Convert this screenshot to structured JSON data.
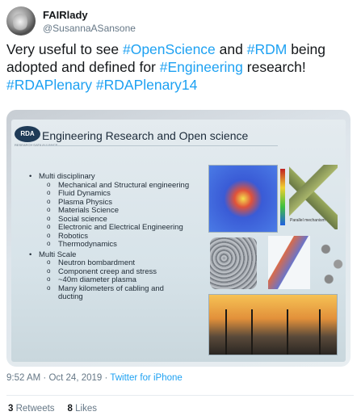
{
  "author": {
    "name": "FAIRlady",
    "handle": "@SusannaASansone"
  },
  "tweet": {
    "text_parts": [
      {
        "text": "Very useful to see ",
        "tag": false
      },
      {
        "text": "#OpenScience",
        "tag": true
      },
      {
        "text": " and ",
        "tag": false
      },
      {
        "text": "#RDM",
        "tag": true
      },
      {
        "text": " being adopted and defined for ",
        "tag": false
      },
      {
        "text": "#Engineering",
        "tag": true
      },
      {
        "text": " research! ",
        "tag": false
      },
      {
        "text": "#RDAPlenary",
        "tag": true
      },
      {
        "text": " ",
        "tag": false
      },
      {
        "text": "#RDAPlenary14",
        "tag": true
      }
    ]
  },
  "slide": {
    "logo": "RDA",
    "logo_sub": "RESEARCH DATA ALLIANCE",
    "title": "Engineering Research and Open science",
    "mech_label": "Parallel mechanism",
    "bullets": [
      {
        "label": "Multi disciplinary",
        "subs": [
          "Mechanical and Structural engineering",
          "Fluid Dynamics",
          "Plasma Physics",
          "Materials Science",
          "Social science",
          "Electronic and Electrical Engineering",
          "Robotics",
          "Thermodynamics"
        ]
      },
      {
        "label": "Multi Scale",
        "subs": [
          "Neutron bombardment",
          "Component creep and stress",
          "~40m diameter plasma",
          "Many kilometers of cabling and ducting"
        ]
      }
    ]
  },
  "meta": {
    "time": "9:52 AM",
    "separator": " · ",
    "date": "Oct 24, 2019",
    "source": "Twitter for iPhone"
  },
  "stats": {
    "retweets_count": "3",
    "retweets_label": "Retweets",
    "likes_count": "8",
    "likes_label": "Likes"
  },
  "colors": {
    "link": "#1da1f2",
    "text": "#14171a",
    "muted": "#657786"
  }
}
